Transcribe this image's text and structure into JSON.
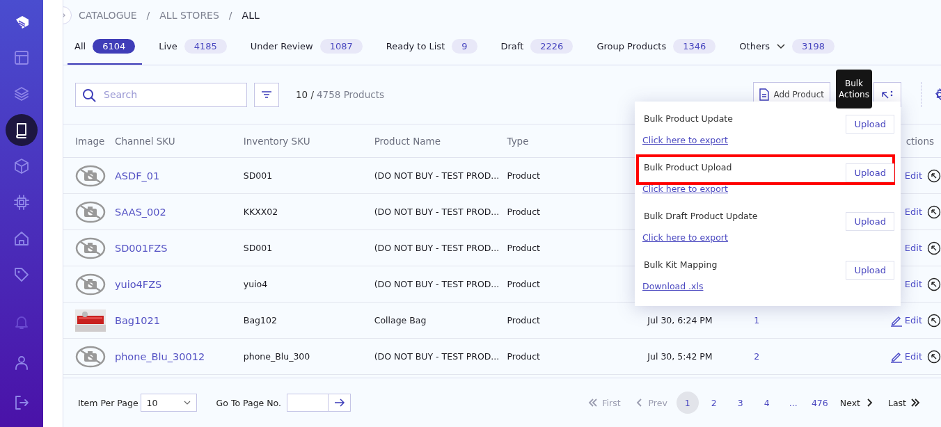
{
  "sidebar": {
    "items": [
      {
        "selected": false
      },
      {
        "selected": false
      },
      {
        "selected": false
      },
      {
        "selected": true
      },
      {
        "selected": false
      },
      {
        "selected": false
      },
      {
        "selected": false
      },
      {
        "selected": false
      }
    ],
    "bottom_items": [
      {
        "disabled": true
      },
      {
        "disabled": false
      },
      {
        "disabled": false
      }
    ]
  },
  "breadcrumb": [
    {
      "label": "CATALOGUE",
      "current": false
    },
    {
      "label": "ALL STORES",
      "current": false
    },
    {
      "label": "ALL",
      "current": true
    }
  ],
  "breadcrumb_separator": "/",
  "tabs": [
    {
      "label": "All",
      "count": "6104",
      "selected": true,
      "kind": "plain"
    },
    {
      "label": "Live",
      "count": "4185",
      "selected": false,
      "kind": "plain"
    },
    {
      "label": "Under Review",
      "count": "1087",
      "selected": false,
      "kind": "plain"
    },
    {
      "label": "Ready to List",
      "count": "9",
      "selected": false,
      "kind": "plain"
    },
    {
      "label": "Draft",
      "count": "2226",
      "selected": false,
      "kind": "plain"
    },
    {
      "label": "Group Products",
      "count": "1346",
      "selected": false,
      "kind": "plain"
    },
    {
      "label": "Others",
      "count": "3198",
      "selected": false,
      "kind": "dropdown"
    }
  ],
  "toolbar": {
    "search": {
      "placeholder": "Search"
    },
    "shown": "10 /",
    "total": "4758 Products",
    "add_button": "Add Product",
    "tooltip": "Bulk Actions"
  },
  "table": {
    "columns": [
      "Image",
      "Channel SKU",
      "Inventory SKU",
      "Product Name",
      "Type",
      "ctions"
    ],
    "rows": [
      {
        "image": {
          "kind": "placeholder"
        },
        "channel_sku": "ASDF_01",
        "inventory_sku": "SD001",
        "product_name": "(DO NOT BUY - TEST PROD...",
        "type": "Product",
        "covered": true,
        "edit": "Edit"
      },
      {
        "image": {
          "kind": "placeholder"
        },
        "channel_sku": "SAAS_002",
        "inventory_sku": "KKXX02",
        "product_name": "(DO NOT BUY - TEST PROD...",
        "type": "Product",
        "covered": true,
        "edit": "Edit"
      },
      {
        "image": {
          "kind": "placeholder"
        },
        "channel_sku": "SD001FZS",
        "inventory_sku": "SD001",
        "product_name": "(DO NOT BUY - TEST PROD...",
        "type": "Product",
        "covered": true,
        "edit": "Edit"
      },
      {
        "image": {
          "kind": "placeholder"
        },
        "channel_sku": "yuio4FZS",
        "inventory_sku": "yuio4",
        "product_name": "(DO NOT BUY - TEST PROD...",
        "type": "Product",
        "covered": true,
        "edit": "Edit"
      },
      {
        "channel_sku": "Bag1021",
        "inventory_sku": "Bag102",
        "product_name": "Collage Bag",
        "type": "Product",
        "covered": false,
        "date": "Jul 30, 6:24 PM",
        "column_7": "1",
        "edit": "Edit"
      },
      {
        "image": {
          "kind": "placeholder"
        },
        "channel_sku": "phone_Blu_30012",
        "inventory_sku": "phone_Blu_300",
        "product_name": "(DO NOT BUY - TEST PROD...",
        "type": "Product",
        "covered": false,
        "date": "Jul 30, 5:42 PM",
        "column_7": "2",
        "edit": "Edit"
      }
    ]
  },
  "bulk_menu": {
    "items": [
      {
        "title": "Bulk Product Update",
        "button": "Upload",
        "link": "Click here to export",
        "highlighted": false
      },
      {
        "title": "Bulk Product Upload",
        "button": "Upload",
        "link": "Click here to export",
        "highlighted": true
      },
      {
        "title": "Bulk Draft Product Update",
        "button": "Upload",
        "link": "Click here to export",
        "highlighted": false
      },
      {
        "title": "Bulk Kit Mapping",
        "button": "Upload",
        "link": "Download .xls",
        "highlighted": false
      }
    ]
  },
  "footer": {
    "per_page_label": "Item Per Page",
    "per_page_value": "10",
    "goto_label": "Go To Page No.",
    "first": {
      "label": "First",
      "disabled": true
    },
    "prev": {
      "label": "Prev",
      "disabled": true
    },
    "pages": [
      {
        "label": "1",
        "selected": true
      },
      {
        "label": "2",
        "selected": false
      },
      {
        "label": "3",
        "selected": false
      },
      {
        "label": "4",
        "selected": false
      },
      {
        "label": "...",
        "selected": false
      },
      {
        "label": "476",
        "selected": false
      }
    ],
    "next": {
      "label": "Next",
      "disabled": false
    },
    "last": {
      "label": "Last",
      "disabled": false
    }
  }
}
